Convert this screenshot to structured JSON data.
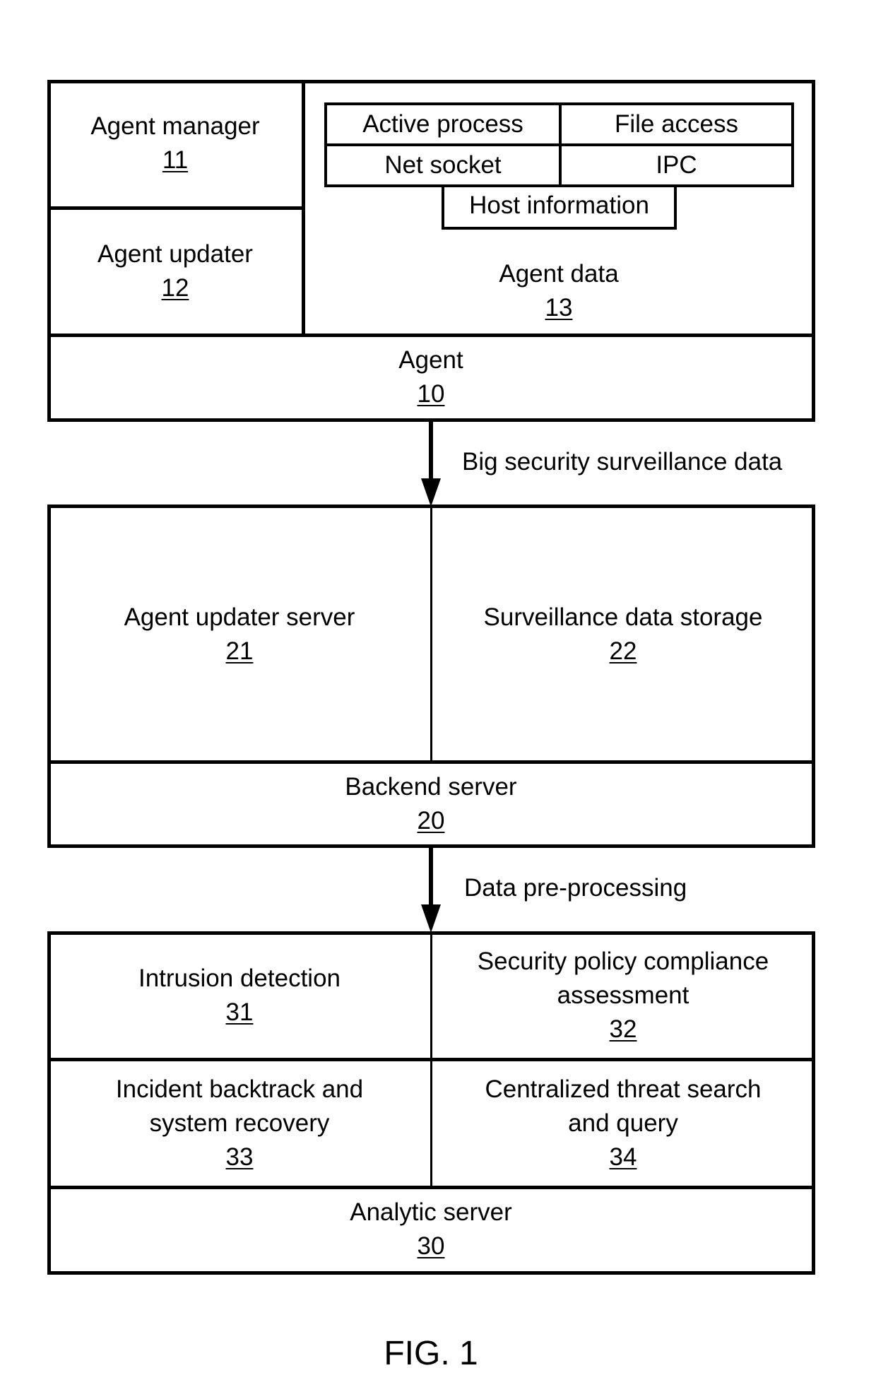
{
  "agent": {
    "title": "Agent",
    "number": "10",
    "manager": {
      "title": "Agent manager",
      "number": "11"
    },
    "updater": {
      "title": "Agent updater",
      "number": "12"
    },
    "data": {
      "title": "Agent data",
      "number": "13",
      "items": [
        "Active process",
        "File access",
        "Net socket",
        "IPC",
        "Host information"
      ]
    }
  },
  "flow1": {
    "label": "Big security surveillance data"
  },
  "backend": {
    "title": "Backend server",
    "number": "20",
    "updater_server": {
      "title": "Agent updater server",
      "number": "21"
    },
    "storage": {
      "title": "Surveillance data storage",
      "number": "22"
    }
  },
  "flow2": {
    "label": "Data pre-processing"
  },
  "analytic": {
    "title": "Analytic server",
    "number": "30",
    "modules": [
      {
        "lines": [
          "Intrusion detection"
        ],
        "number": "31"
      },
      {
        "lines": [
          "Security policy compliance",
          "assessment"
        ],
        "number": "32"
      },
      {
        "lines": [
          "Incident backtrack and",
          "system recovery"
        ],
        "number": "33"
      },
      {
        "lines": [
          "Centralized threat search",
          "and query"
        ],
        "number": "34"
      }
    ]
  },
  "figure": {
    "caption": "FIG. 1"
  }
}
